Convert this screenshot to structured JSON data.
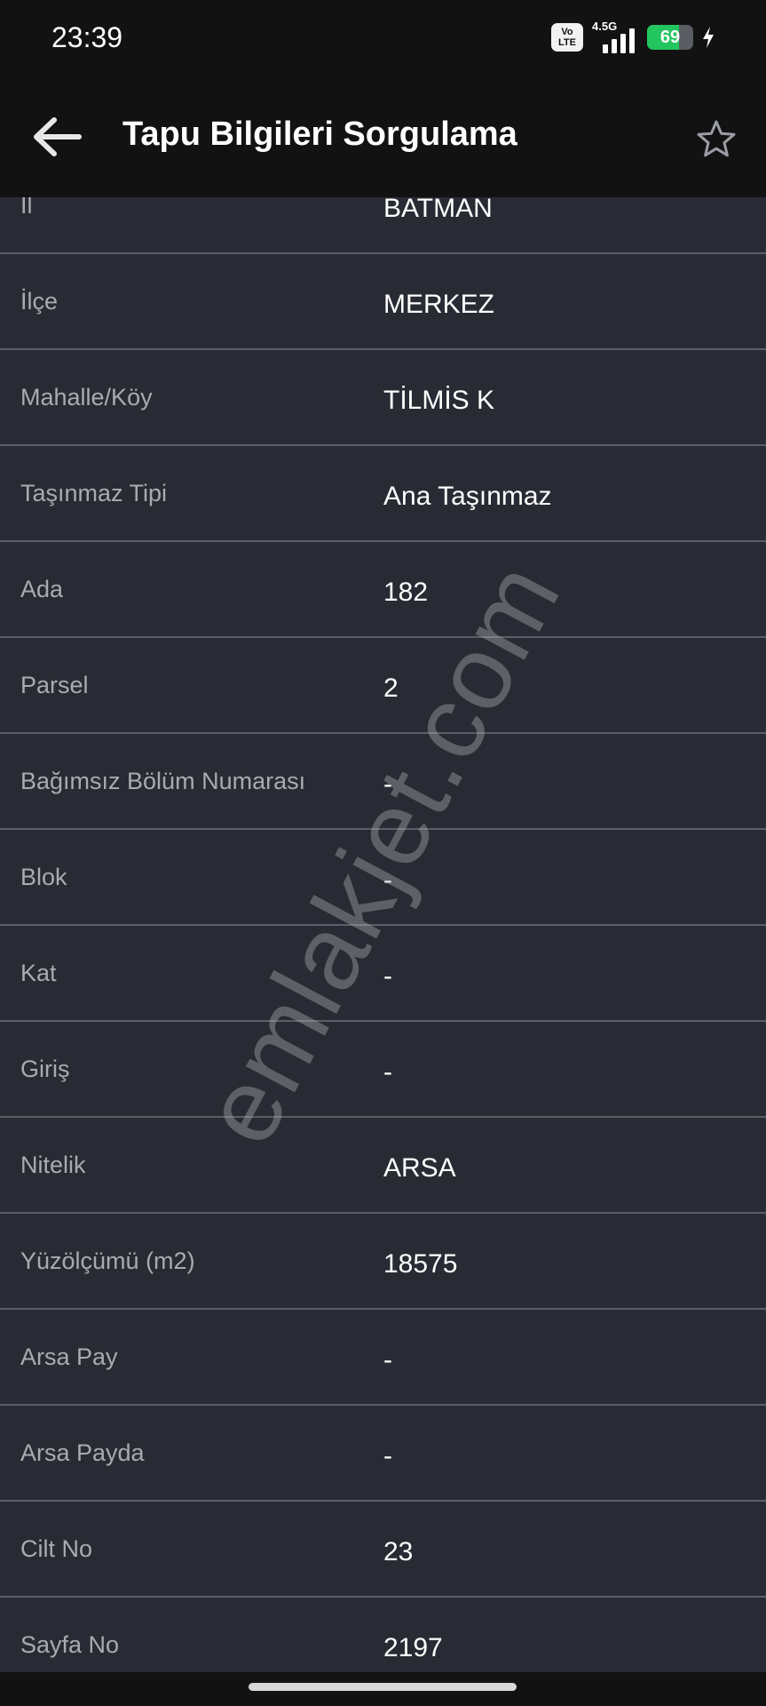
{
  "status_bar": {
    "time": "23:39",
    "volte_line1": "Vo",
    "volte_line2": "LTE",
    "network_type": "4.5G",
    "battery_level": "69",
    "battery_fraction": 0.69,
    "charging": true
  },
  "app_bar": {
    "title": "Tapu Bilgileri Sorgulama",
    "back_icon": "arrow-left-icon",
    "favorite_icon": "star-outline-icon"
  },
  "rows": [
    {
      "label": "İl",
      "value": "BATMAN"
    },
    {
      "label": "İlçe",
      "value": "MERKEZ"
    },
    {
      "label": "Mahalle/Köy",
      "value": "TİLMİS K"
    },
    {
      "label": "Taşınmaz Tipi",
      "value": "Ana Taşınmaz"
    },
    {
      "label": "Ada",
      "value": "182"
    },
    {
      "label": "Parsel",
      "value": "2"
    },
    {
      "label": "Bağımsız Bölüm Numarası",
      "value": "-"
    },
    {
      "label": "Blok",
      "value": "-"
    },
    {
      "label": "Kat",
      "value": "-"
    },
    {
      "label": "Giriş",
      "value": "-"
    },
    {
      "label": "Nitelik",
      "value": "ARSA"
    },
    {
      "label": "Yüzölçümü (m2)",
      "value": "18575"
    },
    {
      "label": "Arsa Pay",
      "value": "-"
    },
    {
      "label": "Arsa Payda",
      "value": "-"
    },
    {
      "label": "Cilt No",
      "value": "23"
    },
    {
      "label": "Sayfa No",
      "value": "2197"
    }
  ],
  "watermark": "emlakjet.com",
  "colors": {
    "background": "#282b33",
    "bar": "#121212",
    "divider": "#5a5e67",
    "label": "#a8abb1",
    "value": "#ffffff",
    "battery": "#22c55e"
  }
}
